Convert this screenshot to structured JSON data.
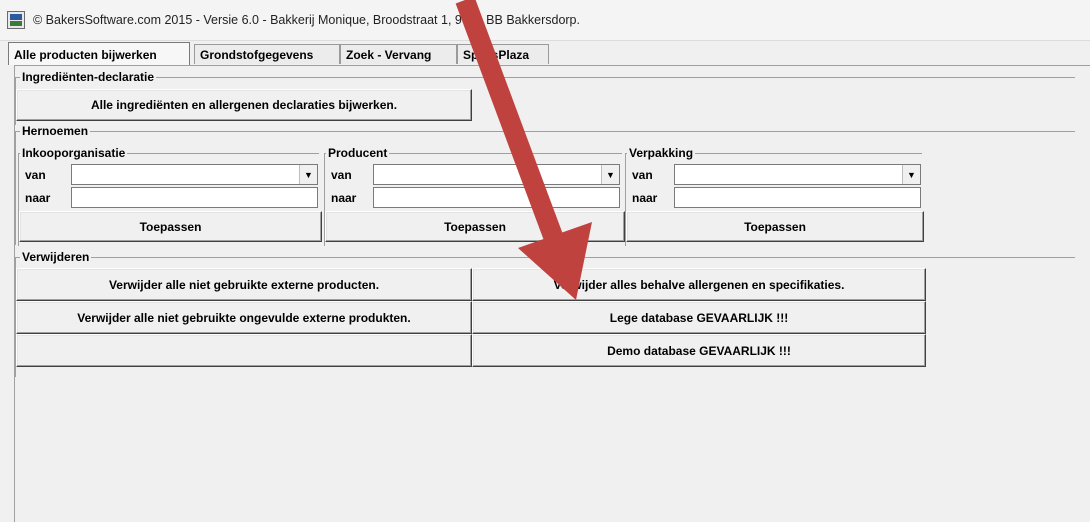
{
  "window": {
    "title": "© BakersSoftware.com 2015 - Versie 6.0 - Bakkerij Monique, Broodstraat 1, 9999 BB Bakkersdorp."
  },
  "tabs": [
    "Alle producten bijwerken",
    "Grondstofgegevens",
    "Zoek - Vervang",
    "SpecsPlaza"
  ],
  "ingredients": {
    "legend": "Ingrediënten-declaratie",
    "update_button": "Alle ingrediënten en allergenen declaraties bijwerken."
  },
  "rename": {
    "legend": "Hernoemen",
    "groups": [
      {
        "title": "Inkooporganisatie",
        "from_label": "van",
        "to_label": "naar",
        "apply": "Toepassen"
      },
      {
        "title": "Producent",
        "from_label": "van",
        "to_label": "naar",
        "apply": "Toepassen"
      },
      {
        "title": "Verpakking",
        "from_label": "van",
        "to_label": "naar",
        "apply": "Toepassen"
      }
    ]
  },
  "delete": {
    "legend": "Verwijderen",
    "buttons": {
      "unused_external": "Verwijder alle niet gebruikte externe producten.",
      "all_except_allergens": "Verwijder alles behalve allergenen en specifikaties.",
      "unused_unfilled": "Verwijder alle niet gebruikte ongevulde externe produkten.",
      "empty_db": "Lege database GEVAARLIJK !!!",
      "demo_db": "Demo database GEVAARLIJK !!!"
    }
  },
  "colors": {
    "annotation_arrow": "#c0423f"
  }
}
